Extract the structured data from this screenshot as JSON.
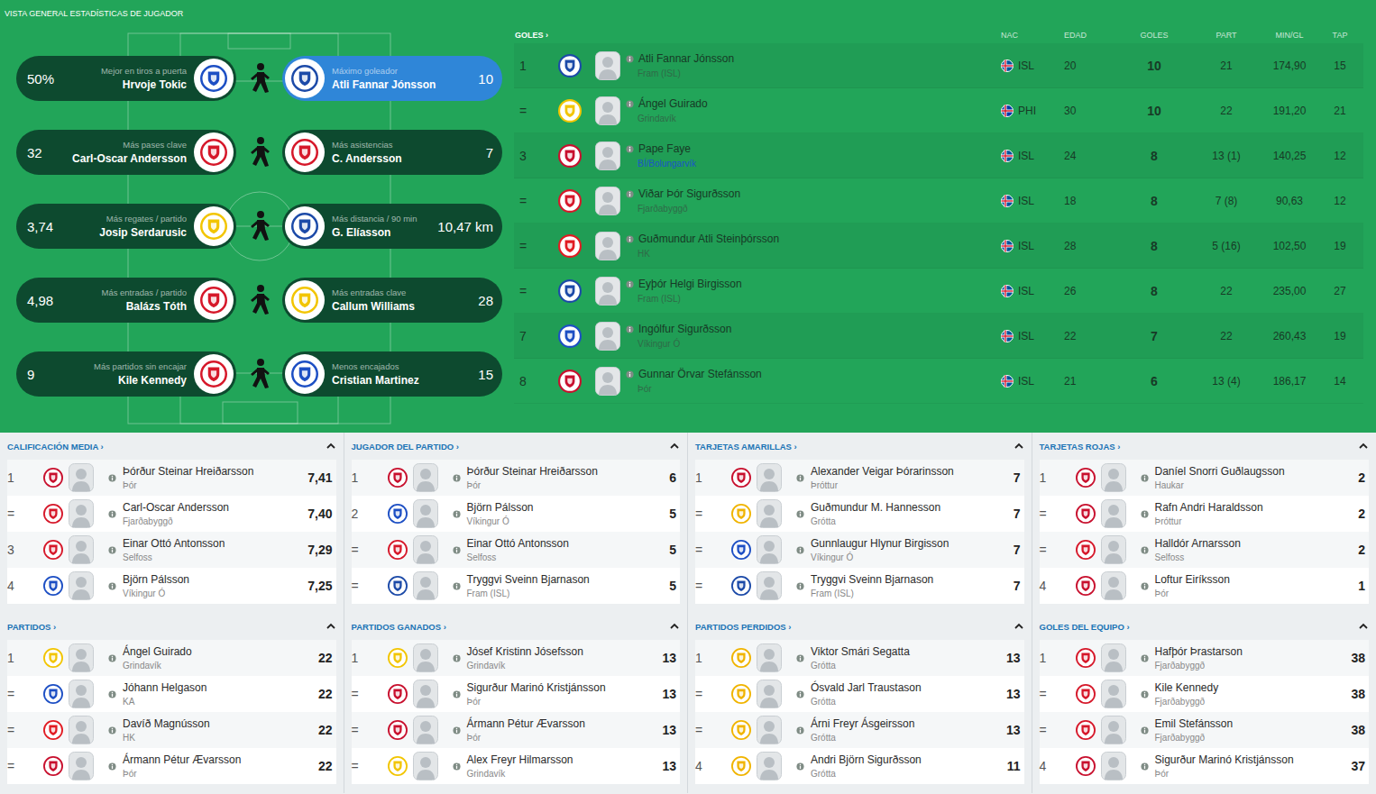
{
  "header": {
    "title": "VISTA GENERAL ESTADÍSTICAS DE JUGADOR"
  },
  "leaders": [
    {
      "left": {
        "value": "50%",
        "label": "Mejor en tiros a puerta",
        "name": "Hrvoje Tokic",
        "crest": "#1d4fc4",
        "selected": false
      },
      "right": {
        "value": "10",
        "label": "Máximo goleador",
        "name": "Atli Fannar Jónsson",
        "crest": "#1c4aa8",
        "selected": true
      }
    },
    {
      "left": {
        "value": "32",
        "label": "Más pases clave",
        "name": "Carl-Oscar Andersson",
        "crest": "#d6182a",
        "selected": false
      },
      "right": {
        "value": "7",
        "label": "Más asistencias",
        "name": "C. Andersson",
        "crest": "#d6182a",
        "selected": false
      }
    },
    {
      "left": {
        "value": "3,74",
        "label": "Más regates / partido",
        "name": "Josip Serdarusic",
        "crest": "#f2c500",
        "selected": false
      },
      "right": {
        "value": "10,47 km",
        "label": "Más distancia / 90 min",
        "name": "G. Elíasson",
        "crest": "#1c4aa8",
        "selected": false
      }
    },
    {
      "left": {
        "value": "4,98",
        "label": "Más entradas / partido",
        "name": "Balázs Tóth",
        "crest": "#d6182a",
        "selected": false
      },
      "right": {
        "value": "28",
        "label": "Más entradas clave",
        "name": "Callum Williams",
        "crest": "#f2c500",
        "selected": false
      }
    },
    {
      "left": {
        "value": "9",
        "label": "Más partidos sin encajar",
        "name": "Kile Kennedy",
        "crest": "#d6182a",
        "selected": false
      },
      "right": {
        "value": "15",
        "label": "Menos encajados",
        "name": "Cristian Martinez",
        "crest": "#1d4fc4",
        "selected": false
      }
    }
  ],
  "goals": {
    "title": "GOLES ›",
    "columns": [
      "NAC",
      "EDAD",
      "GOLES",
      "PART",
      "MIN/GL",
      "TAP"
    ],
    "rows": [
      {
        "rank": "1",
        "name": "Atli Fannar Jónsson",
        "club": "Fram (ISL)",
        "link": false,
        "crest": "#1c4aa8",
        "flag": [
          "#02529C",
          "#DC1E35"
        ],
        "nat": "ISL",
        "age": "20",
        "goals": "10",
        "apps": "21",
        "mingl": "174,90",
        "tap": "15"
      },
      {
        "rank": "=",
        "name": "Ángel Guirado",
        "club": "Grindavík",
        "link": false,
        "crest": "#f2c500",
        "flag": [
          "#0038A8",
          "#CE1126"
        ],
        "nat": "PHI",
        "age": "30",
        "goals": "10",
        "apps": "22",
        "mingl": "191,20",
        "tap": "21"
      },
      {
        "rank": "3",
        "name": "Pape Faye",
        "club": "BÍ/Bolungarvík",
        "link": true,
        "crest": "#c8102e",
        "flag": [
          "#02529C",
          "#DC1E35"
        ],
        "nat": "ISL",
        "age": "24",
        "goals": "8",
        "apps": "13 (1)",
        "mingl": "140,25",
        "tap": "12"
      },
      {
        "rank": "=",
        "name": "Viðar Þór Sigurðsson",
        "club": "Fjarðabyggð",
        "link": false,
        "crest": "#d6182a",
        "flag": [
          "#02529C",
          "#DC1E35"
        ],
        "nat": "ISL",
        "age": "18",
        "goals": "8",
        "apps": "7 (8)",
        "mingl": "90,63",
        "tap": "12"
      },
      {
        "rank": "=",
        "name": "Guðmundur Atli Steinþórsson",
        "club": "HK",
        "link": false,
        "crest": "#e11b22",
        "flag": [
          "#02529C",
          "#DC1E35"
        ],
        "nat": "ISL",
        "age": "28",
        "goals": "8",
        "apps": "5 (16)",
        "mingl": "102,50",
        "tap": "19"
      },
      {
        "rank": "=",
        "name": "Eyþór Helgi Birgisson",
        "club": "Fram (ISL)",
        "link": false,
        "crest": "#1c4aa8",
        "flag": [
          "#02529C",
          "#DC1E35"
        ],
        "nat": "ISL",
        "age": "26",
        "goals": "8",
        "apps": "22",
        "mingl": "235,00",
        "tap": "27"
      },
      {
        "rank": "7",
        "name": "Ingólfur Sigurðsson",
        "club": "Víkingur Ó",
        "link": false,
        "crest": "#1d4fc4",
        "flag": [
          "#02529C",
          "#DC1E35"
        ],
        "nat": "ISL",
        "age": "22",
        "goals": "7",
        "apps": "22",
        "mingl": "260,43",
        "tap": "19"
      },
      {
        "rank": "8",
        "name": "Gunnar Örvar Stefánsson",
        "club": "Þór",
        "link": false,
        "crest": "#c8102e",
        "flag": [
          "#02529C",
          "#DC1E35"
        ],
        "nat": "ISL",
        "age": "21",
        "goals": "6",
        "apps": "13 (4)",
        "mingl": "186,17",
        "tap": "14"
      }
    ]
  },
  "panels": [
    {
      "title": "CALIFICACIÓN MEDIA ›",
      "expanded": true,
      "rows": [
        {
          "rank": "1",
          "name": "Þórður Steinar Hreiðarsson",
          "club": "Þór",
          "crest": "#c8102e",
          "value": "7,41"
        },
        {
          "rank": "=",
          "name": "Carl-Oscar Andersson",
          "club": "Fjarðabyggð",
          "crest": "#d6182a",
          "value": "7,40"
        },
        {
          "rank": "3",
          "name": "Einar Ottó Antonsson",
          "club": "Selfoss",
          "crest": "#d6182a",
          "value": "7,29"
        },
        {
          "rank": "4",
          "name": "Björn Pálsson",
          "club": "Víkingur Ó",
          "crest": "#1d4fc4",
          "value": "7,25"
        }
      ]
    },
    {
      "title": "JUGADOR DEL PARTIDO ›",
      "expanded": true,
      "rows": [
        {
          "rank": "1",
          "name": "Þórður Steinar Hreiðarsson",
          "club": "Þór",
          "crest": "#c8102e",
          "value": "6"
        },
        {
          "rank": "2",
          "name": "Björn Pálsson",
          "club": "Víkingur Ó",
          "crest": "#1d4fc4",
          "value": "5"
        },
        {
          "rank": "=",
          "name": "Einar Ottó Antonsson",
          "club": "Selfoss",
          "crest": "#d6182a",
          "value": "5"
        },
        {
          "rank": "=",
          "name": "Tryggvi Sveinn Bjarnason",
          "club": "Fram (ISL)",
          "crest": "#1c4aa8",
          "value": "5"
        }
      ]
    },
    {
      "title": "TARJETAS AMARILLAS ›",
      "expanded": true,
      "rows": [
        {
          "rank": "1",
          "name": "Alexander Veigar Þórarinsson",
          "club": "Þróttur",
          "crest": "#c8102e",
          "value": "7"
        },
        {
          "rank": "=",
          "name": "Guðmundur M. Hannesson",
          "club": "Grótta",
          "crest": "#f0b400",
          "value": "7"
        },
        {
          "rank": "=",
          "name": "Gunnlaugur Hlynur Birgisson",
          "club": "Víkingur Ó",
          "crest": "#1d4fc4",
          "value": "7"
        },
        {
          "rank": "=",
          "name": "Tryggvi Sveinn Bjarnason",
          "club": "Fram (ISL)",
          "crest": "#1c4aa8",
          "value": "7"
        }
      ]
    },
    {
      "title": "TARJETAS ROJAS ›",
      "expanded": true,
      "rows": [
        {
          "rank": "1",
          "name": "Daníel Snorri Guðlaugsson",
          "club": "Haukar",
          "crest": "#c8102e",
          "value": "2"
        },
        {
          "rank": "=",
          "name": "Rafn Andri Haraldsson",
          "club": "Þróttur",
          "crest": "#c8102e",
          "value": "2"
        },
        {
          "rank": "=",
          "name": "Halldór Arnarsson",
          "club": "Selfoss",
          "crest": "#d6182a",
          "value": "2"
        },
        {
          "rank": "4",
          "name": "Loftur Eiríksson",
          "club": "Þór",
          "crest": "#c8102e",
          "value": "1"
        }
      ]
    },
    {
      "title": "PARTIDOS ›",
      "expanded": true,
      "rows": [
        {
          "rank": "1",
          "name": "Ángel Guirado",
          "club": "Grindavík",
          "crest": "#f2c500",
          "value": "22"
        },
        {
          "rank": "=",
          "name": "Jóhann Helgason",
          "club": "KA",
          "crest": "#1d4fc4",
          "value": "22"
        },
        {
          "rank": "=",
          "name": "Davíð Magnússon",
          "club": "HK",
          "crest": "#e11b22",
          "value": "22"
        },
        {
          "rank": "=",
          "name": "Ármann Pétur Ævarsson",
          "club": "Þór",
          "crest": "#c8102e",
          "value": "22"
        }
      ]
    },
    {
      "title": "PARTIDOS GANADOS ›",
      "expanded": true,
      "rows": [
        {
          "rank": "1",
          "name": "Jósef Kristinn Jósefsson",
          "club": "Grindavík",
          "crest": "#f2c500",
          "value": "13"
        },
        {
          "rank": "=",
          "name": "Sigurður Marinó Kristjánsson",
          "club": "Þór",
          "crest": "#c8102e",
          "value": "13"
        },
        {
          "rank": "=",
          "name": "Ármann Pétur Ævarsson",
          "club": "Þór",
          "crest": "#c8102e",
          "value": "13"
        },
        {
          "rank": "=",
          "name": "Alex Freyr Hilmarsson",
          "club": "Grindavík",
          "crest": "#f2c500",
          "value": "13"
        }
      ]
    },
    {
      "title": "PARTIDOS PERDIDOS ›",
      "expanded": true,
      "rows": [
        {
          "rank": "1",
          "name": "Viktor Smári Segatta",
          "club": "Grótta",
          "crest": "#f0b400",
          "value": "13"
        },
        {
          "rank": "=",
          "name": "Ósvald Jarl Traustason",
          "club": "Grótta",
          "crest": "#f0b400",
          "value": "13"
        },
        {
          "rank": "=",
          "name": "Árni Freyr Ásgeirsson",
          "club": "Grótta",
          "crest": "#f0b400",
          "value": "13"
        },
        {
          "rank": "4",
          "name": "Andri Björn Sigurðsson",
          "club": "Grótta",
          "crest": "#f0b400",
          "value": "11"
        }
      ]
    },
    {
      "title": "GOLES DEL EQUIPO ›",
      "expanded": true,
      "rows": [
        {
          "rank": "1",
          "name": "Hafþór Þrastarson",
          "club": "Fjarðabyggð",
          "crest": "#d6182a",
          "value": "38"
        },
        {
          "rank": "=",
          "name": "Kile Kennedy",
          "club": "Fjarðabyggð",
          "crest": "#d6182a",
          "value": "38"
        },
        {
          "rank": "=",
          "name": "Emil Stefánsson",
          "club": "Fjarðabyggð",
          "crest": "#d6182a",
          "value": "38"
        },
        {
          "rank": "4",
          "name": "Sigurður Marinó Kristjánsson",
          "club": "Þór",
          "crest": "#c8102e",
          "value": "37"
        }
      ]
    }
  ]
}
